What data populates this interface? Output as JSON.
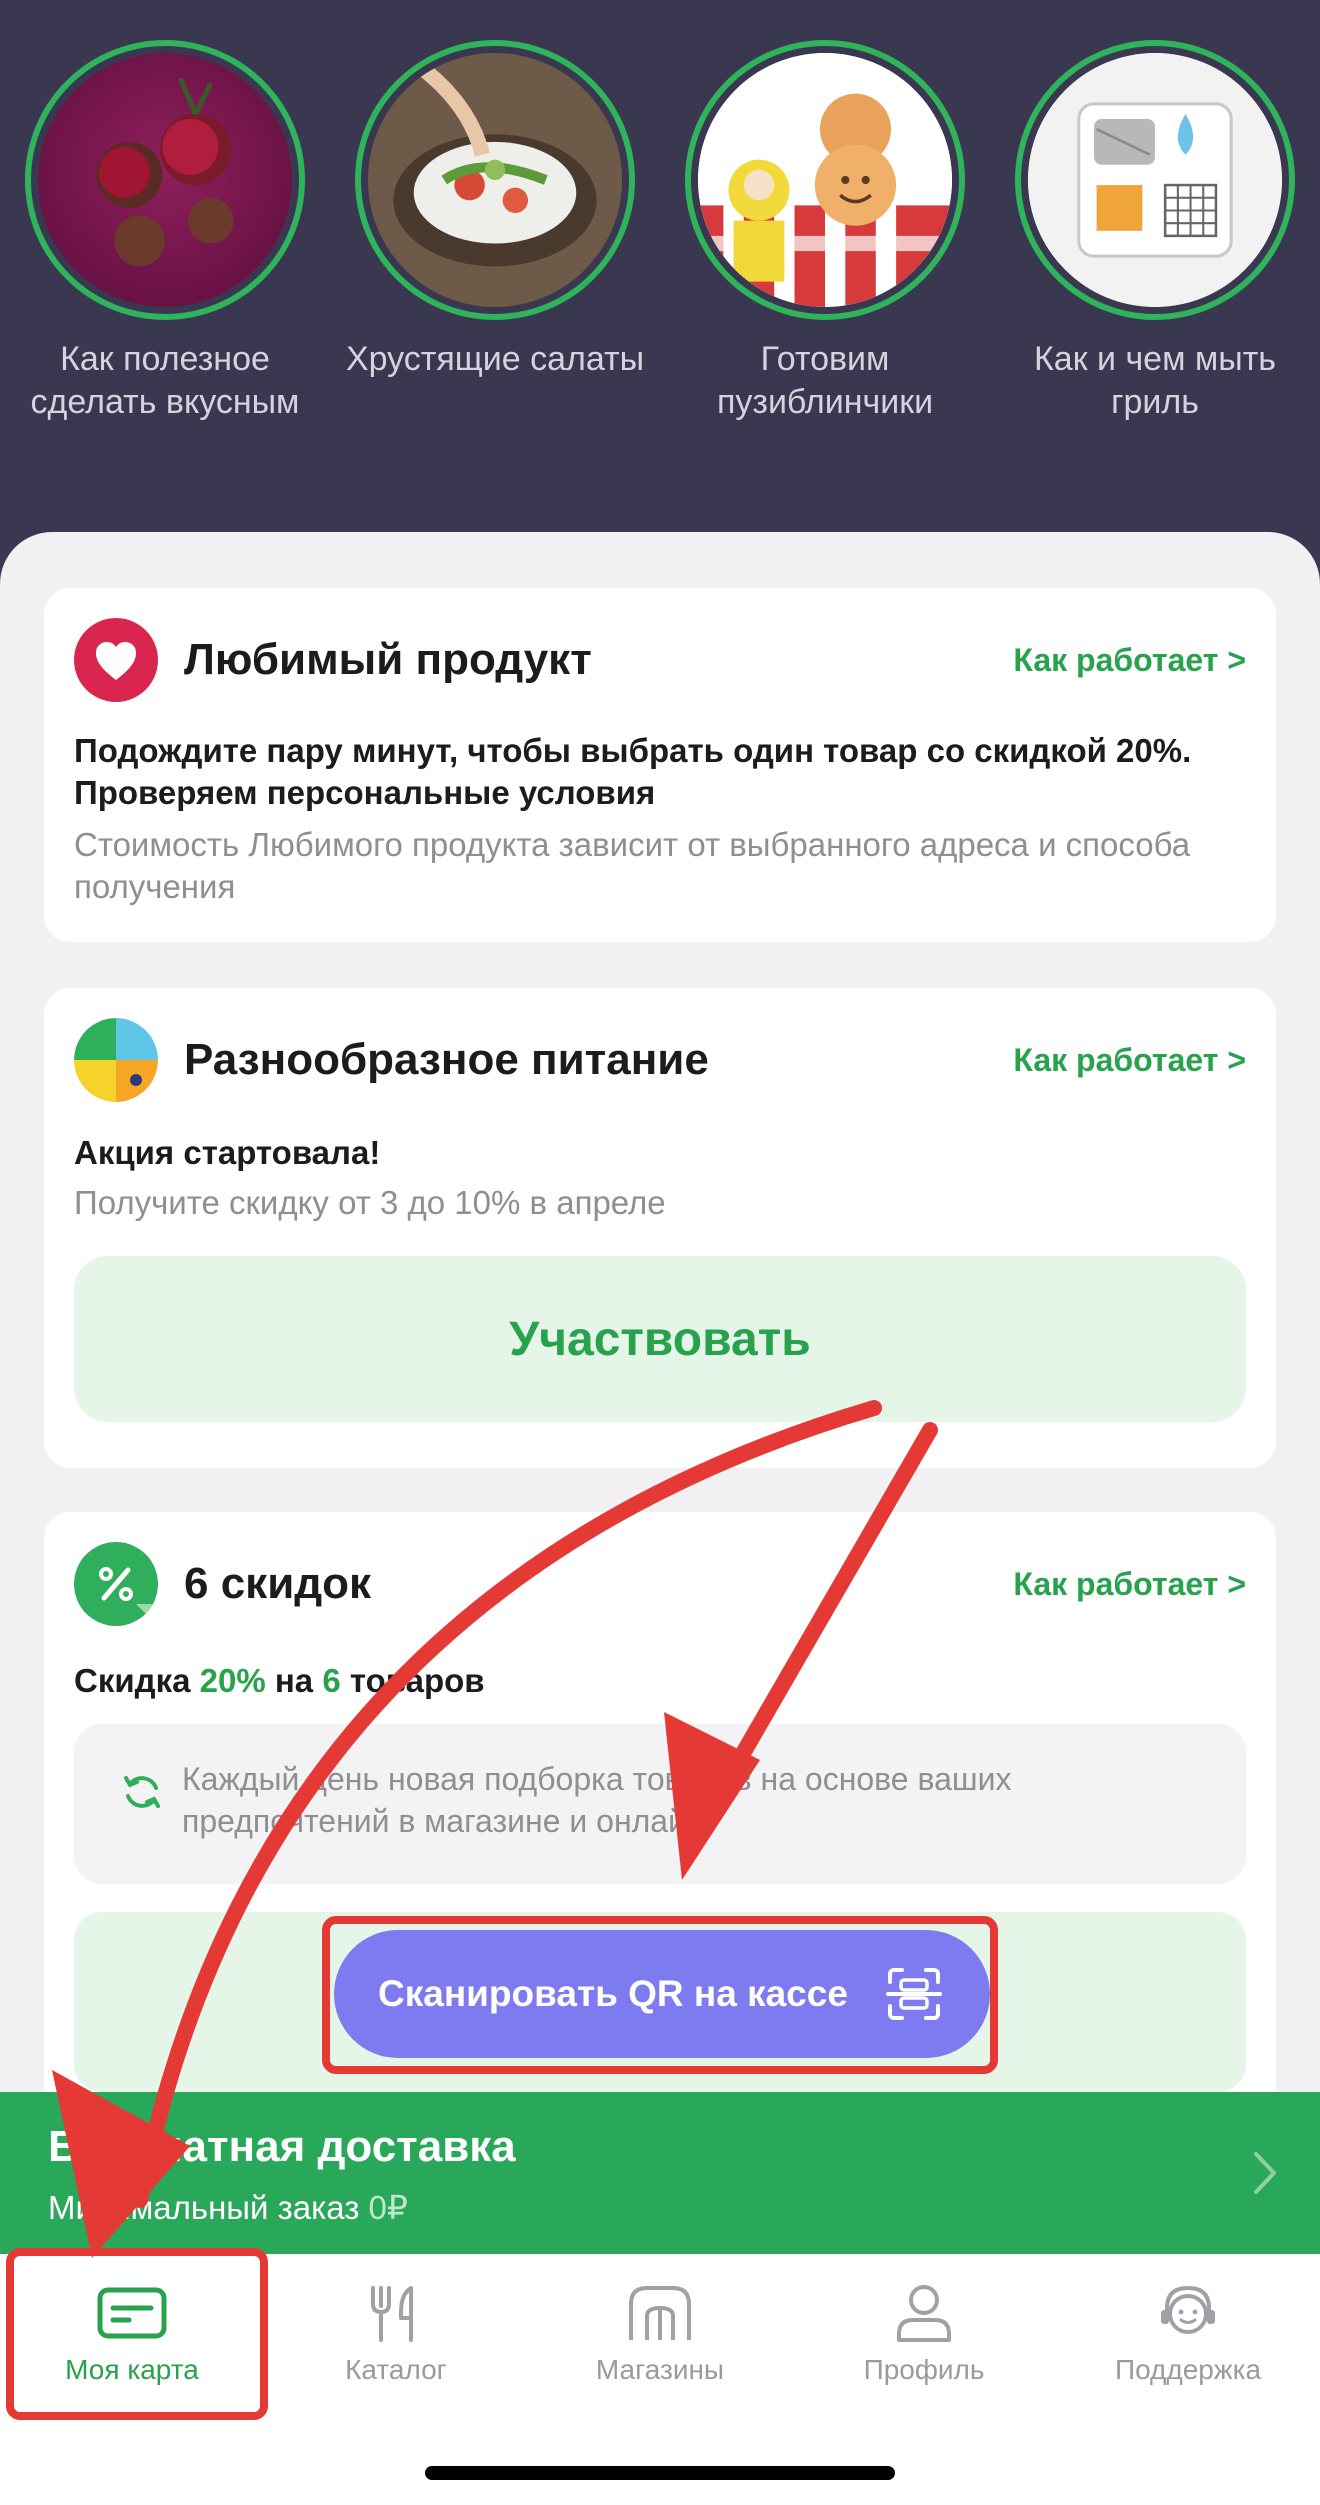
{
  "stories": [
    {
      "label": "Как полезное сделать вкусным",
      "icon": "beet-image"
    },
    {
      "label": "Хрустящие салаты",
      "icon": "salad-image"
    },
    {
      "label": "Готовим пузиблинчики",
      "icon": "pancakes-image"
    },
    {
      "label": "Как и чем мыть гриль",
      "icon": "grill-image"
    }
  ],
  "cards": {
    "favorite": {
      "title": "Любимый продукт",
      "link": "Как работает >",
      "text": "Подождите пару минут, чтобы выбрать один товар со скидкой 20%. Проверяем персональные условия",
      "note": "Стоимость Любимого продукта зависит от выбранного адреса и способа получения"
    },
    "variety": {
      "title": "Разнообразное питание",
      "link": "Как работает >",
      "text": "Акция стартовала!",
      "note": "Получите скидку от 3 до 10% в апреле",
      "button": "Участвовать"
    },
    "discounts": {
      "title": "6 скидок",
      "link": "Как работает >",
      "line_prefix": "Скидка",
      "percent": "20%",
      "line_middle": "на",
      "count": "6",
      "line_suffix": "товаров",
      "info": "Каждый день новая подборка товаров на основе ваших предпочтений в магазине и онлайн.",
      "scan_button": "Сканировать QR на кассе"
    }
  },
  "delivery": {
    "title": "Бесплатная доставка",
    "sub_label": "Минимальный заказ",
    "sub_value": "0₽"
  },
  "tabs": [
    {
      "label": "Моя карта",
      "icon": "card-icon",
      "active": true
    },
    {
      "label": "Каталог",
      "icon": "fork-knife-icon",
      "active": false
    },
    {
      "label": "Магазины",
      "icon": "store-icon",
      "active": false
    },
    {
      "label": "Профиль",
      "icon": "person-icon",
      "active": false
    },
    {
      "label": "Поддержка",
      "icon": "headset-icon",
      "active": false
    }
  ],
  "colors": {
    "hero_bg": "#3a3850",
    "accent_green": "#28a24d",
    "delivery_green": "#2aa85a",
    "scan_purple": "#7e7bf1",
    "heart_red": "#d9264f",
    "annotation_red": "#e53935"
  }
}
